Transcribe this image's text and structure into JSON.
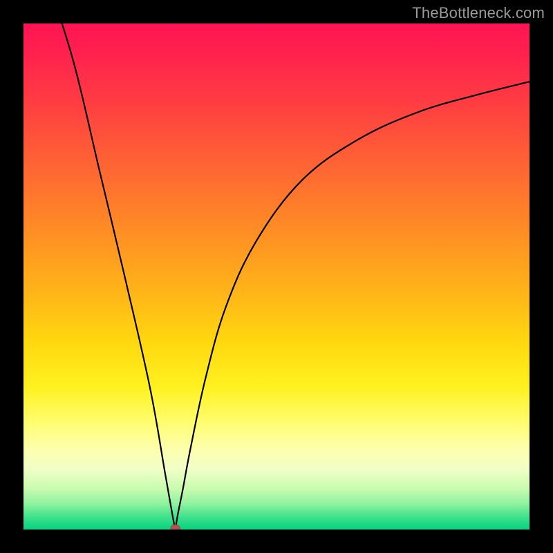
{
  "watermark": "TheBottleneck.com",
  "chart_data": {
    "type": "line",
    "title": "",
    "xlabel": "",
    "ylabel": "",
    "xlim": [
      0,
      100
    ],
    "ylim": [
      0,
      100
    ],
    "grid": false,
    "legend": false,
    "marker": {
      "x": 30,
      "y": 0,
      "color": "#b1544e"
    },
    "series": [
      {
        "name": "left-branch",
        "x": [
          5,
          10,
          15,
          20,
          25,
          28,
          29.5,
          30
        ],
        "values": [
          108,
          92,
          71,
          50,
          28,
          11,
          2.5,
          0
        ]
      },
      {
        "name": "right-branch",
        "x": [
          30,
          30.5,
          31.5,
          33,
          36,
          40,
          46,
          55,
          66,
          78,
          90,
          100
        ],
        "values": [
          0,
          3,
          8,
          16,
          30,
          44,
          57,
          69,
          77,
          82.5,
          86,
          88.5
        ]
      }
    ],
    "background_gradient": {
      "direction": "top-to-bottom",
      "stops": [
        {
          "pos": 0.0,
          "color": "#ff1452"
        },
        {
          "pos": 0.28,
          "color": "#ff6434"
        },
        {
          "pos": 0.53,
          "color": "#ffb418"
        },
        {
          "pos": 0.78,
          "color": "#fffc66"
        },
        {
          "pos": 0.95,
          "color": "#8df29e"
        },
        {
          "pos": 1.0,
          "color": "#0cd280"
        }
      ]
    }
  }
}
